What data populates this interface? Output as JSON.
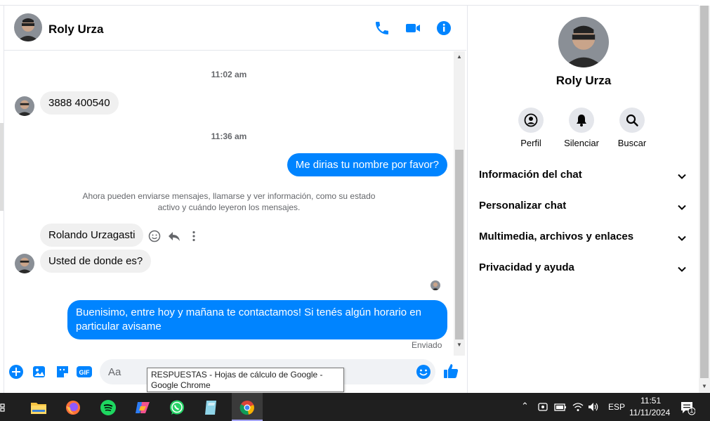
{
  "contact": {
    "name": "Roly Urza"
  },
  "header": {
    "call_icon": "phone-icon",
    "video_icon": "video-icon",
    "info_icon": "info-icon"
  },
  "messages": {
    "time1": "11:02 am",
    "in1": "3888 400540",
    "time2": "11:36 am",
    "out1": "Me dirias tu nombre por favor?",
    "system": "Ahora pueden enviarse mensajes, llamarse y ver información, como su estado activo y cuándo leyeron los mensajes.",
    "in2": "Rolando Urzagasti",
    "in3": "Usted de donde es?",
    "out2": "Buenisimo, entre hoy y mañana te contactamos! Si tenés algún horario en particular avisame",
    "status": "Enviado"
  },
  "composer": {
    "placeholder": "Aa"
  },
  "tooltip": "RESPUESTAS - Hojas de cálculo de Google - Google Chrome",
  "right_panel": {
    "actions": [
      {
        "label": "Perfil",
        "icon": "profile-icon"
      },
      {
        "label": "Silenciar",
        "icon": "bell-icon"
      },
      {
        "label": "Buscar",
        "icon": "search-icon"
      }
    ],
    "sections": [
      "Información del chat",
      "Personalizar chat",
      "Multimedia, archivos y enlaces",
      "Privacidad y ayuda"
    ]
  },
  "taskbar": {
    "lang": "ESP",
    "time": "11:51",
    "date": "11/11/2024",
    "notif_count": "1"
  },
  "colors": {
    "accent": "#0084ff",
    "bubble_in": "#f0f0f0"
  }
}
